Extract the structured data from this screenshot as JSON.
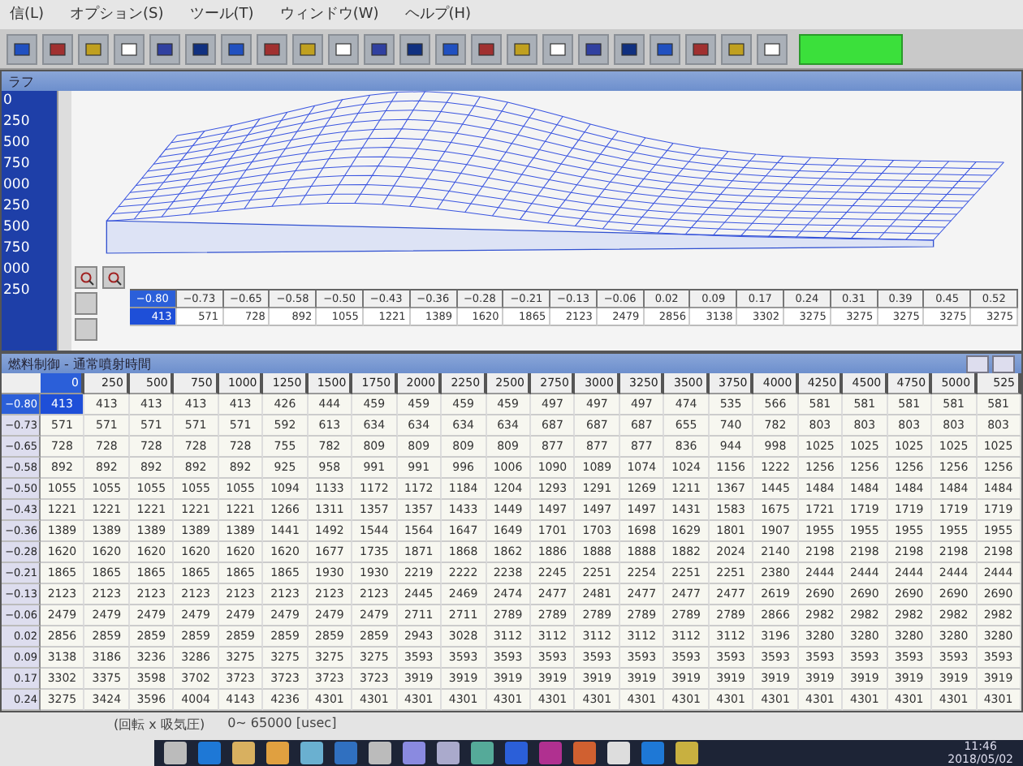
{
  "menu": [
    "信(L)",
    "オプション(S)",
    "ツール(T)",
    "ウィンドウ(W)",
    "ヘルプ(H)"
  ],
  "graph_window": {
    "title": "ラフ",
    "list": [
      "0",
      "250",
      "500",
      "750",
      "000",
      "250",
      "500",
      "750",
      "000",
      "250"
    ],
    "strip": {
      "columns": [
        {
          "label": "−0.80",
          "selected": true
        },
        {
          "label": "−0.73",
          "selected": false
        },
        {
          "label": "−0.65",
          "selected": false
        },
        {
          "label": "−0.58",
          "selected": false
        },
        {
          "label": "−0.50",
          "selected": false
        },
        {
          "label": "−0.43",
          "selected": false
        },
        {
          "label": "−0.36",
          "selected": false
        },
        {
          "label": "−0.28",
          "selected": false
        },
        {
          "label": "−0.21",
          "selected": false
        },
        {
          "label": "−0.13",
          "selected": false
        },
        {
          "label": "−0.06",
          "selected": false
        },
        {
          "label": "0.02",
          "selected": false
        },
        {
          "label": "0.09",
          "selected": false
        },
        {
          "label": "0.17",
          "selected": false
        },
        {
          "label": "0.24",
          "selected": false
        },
        {
          "label": "0.31",
          "selected": false
        },
        {
          "label": "0.39",
          "selected": false
        },
        {
          "label": "0.45",
          "selected": false
        },
        {
          "label": "0.52",
          "selected": false
        }
      ],
      "values": [
        "413",
        "571",
        "728",
        "892",
        "1055",
        "1221",
        "1389",
        "1620",
        "1865",
        "2123",
        "2479",
        "2856",
        "3138",
        "3302",
        "3275",
        "3275",
        "3275",
        "3275",
        "3275"
      ]
    }
  },
  "table_window": {
    "title": "燃料制御 - 通常噴射時間",
    "columns": [
      {
        "label": "0",
        "selected": true
      },
      {
        "label": "250",
        "selected": false
      },
      {
        "label": "500",
        "selected": false
      },
      {
        "label": "750",
        "selected": false
      },
      {
        "label": "1000",
        "selected": false
      },
      {
        "label": "1250",
        "selected": false
      },
      {
        "label": "1500",
        "selected": false
      },
      {
        "label": "1750",
        "selected": false
      },
      {
        "label": "2000",
        "selected": false
      },
      {
        "label": "2250",
        "selected": false
      },
      {
        "label": "2500",
        "selected": false
      },
      {
        "label": "2750",
        "selected": false
      },
      {
        "label": "3000",
        "selected": false
      },
      {
        "label": "3250",
        "selected": false
      },
      {
        "label": "3500",
        "selected": false
      },
      {
        "label": "3750",
        "selected": false
      },
      {
        "label": "4000",
        "selected": false
      },
      {
        "label": "4250",
        "selected": false
      },
      {
        "label": "4500",
        "selected": false
      },
      {
        "label": "4750",
        "selected": false
      },
      {
        "label": "5000",
        "selected": false
      },
      {
        "label": "525",
        "selected": false
      }
    ],
    "rows": [
      {
        "label": "−0.80",
        "selected": true,
        "values": [
          "413",
          "413",
          "413",
          "413",
          "413",
          "426",
          "444",
          "459",
          "459",
          "459",
          "459",
          "497",
          "497",
          "497",
          "474",
          "535",
          "566",
          "581",
          "581",
          "581",
          "581",
          "581"
        ]
      },
      {
        "label": "−0.73",
        "selected": false,
        "values": [
          "571",
          "571",
          "571",
          "571",
          "571",
          "592",
          "613",
          "634",
          "634",
          "634",
          "634",
          "687",
          "687",
          "687",
          "655",
          "740",
          "782",
          "803",
          "803",
          "803",
          "803",
          "803"
        ]
      },
      {
        "label": "−0.65",
        "selected": false,
        "values": [
          "728",
          "728",
          "728",
          "728",
          "728",
          "755",
          "782",
          "809",
          "809",
          "809",
          "809",
          "877",
          "877",
          "877",
          "836",
          "944",
          "998",
          "1025",
          "1025",
          "1025",
          "1025",
          "1025"
        ]
      },
      {
        "label": "−0.58",
        "selected": false,
        "values": [
          "892",
          "892",
          "892",
          "892",
          "892",
          "925",
          "958",
          "991",
          "991",
          "996",
          "1006",
          "1090",
          "1089",
          "1074",
          "1024",
          "1156",
          "1222",
          "1256",
          "1256",
          "1256",
          "1256",
          "1256"
        ]
      },
      {
        "label": "−0.50",
        "selected": false,
        "values": [
          "1055",
          "1055",
          "1055",
          "1055",
          "1055",
          "1094",
          "1133",
          "1172",
          "1172",
          "1184",
          "1204",
          "1293",
          "1291",
          "1269",
          "1211",
          "1367",
          "1445",
          "1484",
          "1484",
          "1484",
          "1484",
          "1484"
        ]
      },
      {
        "label": "−0.43",
        "selected": false,
        "values": [
          "1221",
          "1221",
          "1221",
          "1221",
          "1221",
          "1266",
          "1311",
          "1357",
          "1357",
          "1433",
          "1449",
          "1497",
          "1497",
          "1497",
          "1431",
          "1583",
          "1675",
          "1721",
          "1719",
          "1719",
          "1719",
          "1719"
        ]
      },
      {
        "label": "−0.36",
        "selected": false,
        "values": [
          "1389",
          "1389",
          "1389",
          "1389",
          "1389",
          "1441",
          "1492",
          "1544",
          "1564",
          "1647",
          "1649",
          "1701",
          "1703",
          "1698",
          "1629",
          "1801",
          "1907",
          "1955",
          "1955",
          "1955",
          "1955",
          "1955"
        ]
      },
      {
        "label": "−0.28",
        "selected": false,
        "values": [
          "1620",
          "1620",
          "1620",
          "1620",
          "1620",
          "1620",
          "1677",
          "1735",
          "1871",
          "1868",
          "1862",
          "1886",
          "1888",
          "1888",
          "1882",
          "2024",
          "2140",
          "2198",
          "2198",
          "2198",
          "2198",
          "2198"
        ]
      },
      {
        "label": "−0.21",
        "selected": false,
        "values": [
          "1865",
          "1865",
          "1865",
          "1865",
          "1865",
          "1865",
          "1930",
          "1930",
          "2219",
          "2222",
          "2238",
          "2245",
          "2251",
          "2254",
          "2251",
          "2251",
          "2380",
          "2444",
          "2444",
          "2444",
          "2444",
          "2444"
        ]
      },
      {
        "label": "−0.13",
        "selected": false,
        "values": [
          "2123",
          "2123",
          "2123",
          "2123",
          "2123",
          "2123",
          "2123",
          "2123",
          "2445",
          "2469",
          "2474",
          "2477",
          "2481",
          "2477",
          "2477",
          "2477",
          "2619",
          "2690",
          "2690",
          "2690",
          "2690",
          "2690"
        ]
      },
      {
        "label": "−0.06",
        "selected": false,
        "values": [
          "2479",
          "2479",
          "2479",
          "2479",
          "2479",
          "2479",
          "2479",
          "2479",
          "2711",
          "2711",
          "2789",
          "2789",
          "2789",
          "2789",
          "2789",
          "2789",
          "2866",
          "2982",
          "2982",
          "2982",
          "2982",
          "2982"
        ]
      },
      {
        "label": "0.02",
        "selected": false,
        "values": [
          "2856",
          "2859",
          "2859",
          "2859",
          "2859",
          "2859",
          "2859",
          "2859",
          "2943",
          "3028",
          "3112",
          "3112",
          "3112",
          "3112",
          "3112",
          "3112",
          "3196",
          "3280",
          "3280",
          "3280",
          "3280",
          "3280"
        ]
      },
      {
        "label": "0.09",
        "selected": false,
        "values": [
          "3138",
          "3186",
          "3236",
          "3286",
          "3275",
          "3275",
          "3275",
          "3275",
          "3593",
          "3593",
          "3593",
          "3593",
          "3593",
          "3593",
          "3593",
          "3593",
          "3593",
          "3593",
          "3593",
          "3593",
          "3593",
          "3593"
        ]
      },
      {
        "label": "0.17",
        "selected": false,
        "values": [
          "3302",
          "3375",
          "3598",
          "3702",
          "3723",
          "3723",
          "3723",
          "3723",
          "3919",
          "3919",
          "3919",
          "3919",
          "3919",
          "3919",
          "3919",
          "3919",
          "3919",
          "3919",
          "3919",
          "3919",
          "3919",
          "3919"
        ]
      },
      {
        "label": "0.24",
        "selected": false,
        "values": [
          "3275",
          "3424",
          "3596",
          "4004",
          "4143",
          "4236",
          "4301",
          "4301",
          "4301",
          "4301",
          "4301",
          "4301",
          "4301",
          "4301",
          "4301",
          "4301",
          "4301",
          "4301",
          "4301",
          "4301",
          "4301",
          "4301"
        ]
      }
    ]
  },
  "status_bar": {
    "axes": "(回転 x 吸気圧)",
    "range": "0~ 65000 [usec]"
  },
  "taskbar": {
    "time": "11:46",
    "date": "2018/05/02"
  }
}
